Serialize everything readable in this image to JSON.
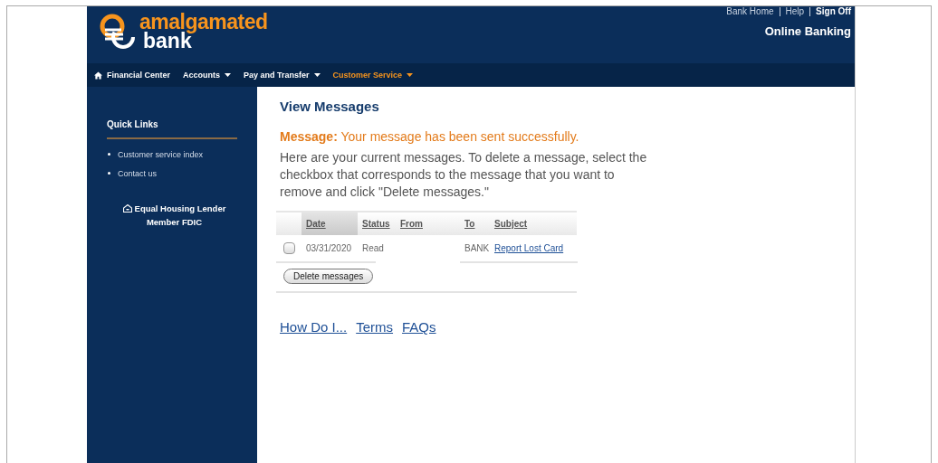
{
  "logo": {
    "line_1": "amalgamated",
    "line_2": "bank"
  },
  "top_links": [
    {
      "label": "Bank Home",
      "bold": false
    },
    {
      "label": "Help",
      "bold": false
    },
    {
      "label": "Sign Off",
      "bold": true
    }
  ],
  "header_title": "Online Banking",
  "nav": [
    {
      "label": "Financial Center",
      "kind": "home",
      "selected": false
    },
    {
      "label": "Accounts",
      "kind": "menu",
      "selected": false
    },
    {
      "label": "Pay and Transfer",
      "kind": "menu",
      "selected": false
    },
    {
      "label": "Customer Service",
      "kind": "menu",
      "selected": true
    }
  ],
  "sidebar": {
    "heading": "Quick Links",
    "items": [
      "Customer service index",
      "Contact us"
    ],
    "lender_line_1": "Equal Housing Lender",
    "lender_line_2": "Member FDIC"
  },
  "page_title": "View Messages",
  "status_message": "**Message:** Your message has been sent successfully.",
  "instructions": "Here are your current messages. To delete a message, select the checkbox that corresponds to the message that you want to remove and click \"Delete messages.\"",
  "table": {
    "columns": [
      {
        "label": "Date",
        "selected": true
      },
      {
        "label": "Status",
        "selected": false
      },
      {
        "label": "From",
        "selected": false
      },
      {
        "label": "To",
        "selected": false
      },
      {
        "label": "Subject",
        "selected": false
      }
    ],
    "rows": [
      {
        "checked": false,
        "date": "03/31/2020",
        "status": "Read",
        "to": "BANK",
        "subject": "Report Lost Card"
      }
    ]
  },
  "delete_button": "Delete messages",
  "footer_links": [
    "How Do I...",
    "Terms",
    "FAQs"
  ]
}
